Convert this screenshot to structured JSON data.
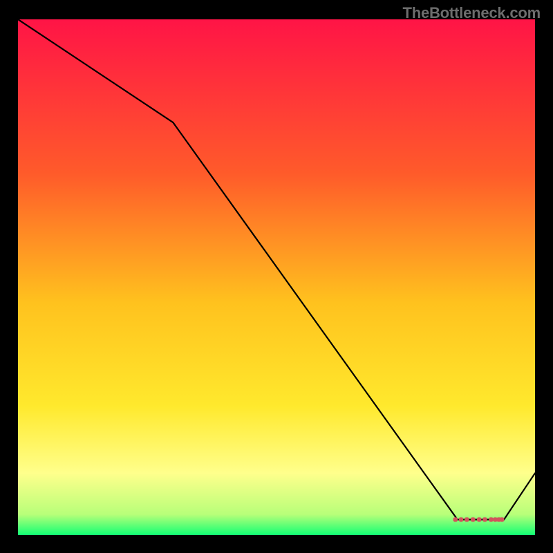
{
  "watermark": "TheBottleneck.com",
  "chart_data": {
    "type": "line",
    "title": "",
    "xlabel": "",
    "ylabel": "",
    "xlim": [
      0,
      100
    ],
    "ylim": [
      0,
      100
    ],
    "series": [
      {
        "name": "curve",
        "x": [
          0,
          30,
          85,
          94,
          100
        ],
        "y": [
          100,
          80,
          3,
          3,
          12
        ]
      }
    ],
    "markers": {
      "name": "flat-segment-markers",
      "x": [
        84.6,
        85.7,
        86.8,
        88.0,
        89.2,
        90.3,
        91.5,
        92.3,
        93.0,
        93.6
      ],
      "y": [
        3.0,
        3.0,
        3.0,
        3.0,
        3.0,
        3.0,
        3.0,
        3.0,
        3.0,
        3.0
      ]
    },
    "gradient_stops": [
      {
        "offset": 0.0,
        "color": "#ff1446"
      },
      {
        "offset": 0.3,
        "color": "#ff5b2a"
      },
      {
        "offset": 0.55,
        "color": "#ffc21e"
      },
      {
        "offset": 0.75,
        "color": "#ffe92d"
      },
      {
        "offset": 0.88,
        "color": "#ffff8c"
      },
      {
        "offset": 0.96,
        "color": "#b8ff79"
      },
      {
        "offset": 1.0,
        "color": "#12ff74"
      }
    ],
    "line_color": "#000000",
    "marker_color": "#d1555c"
  }
}
